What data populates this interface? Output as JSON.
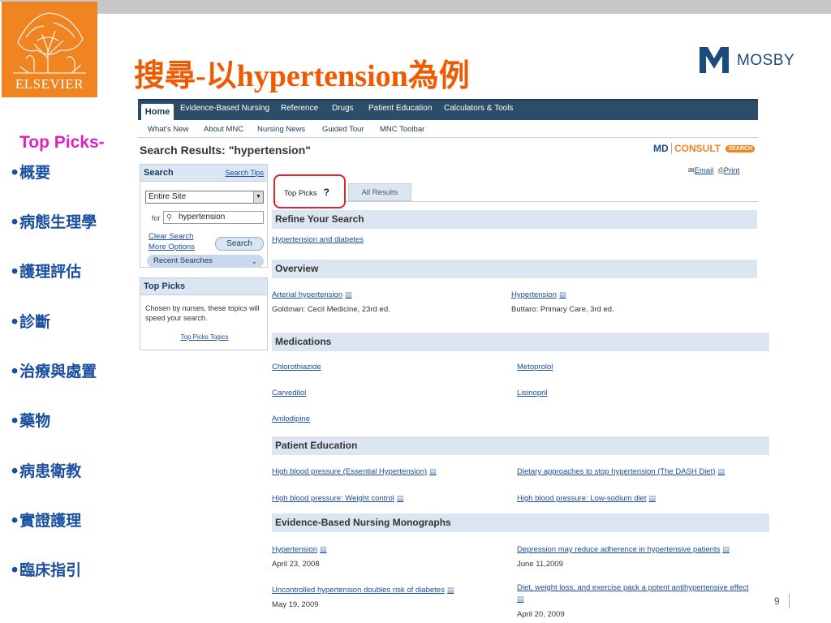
{
  "slide": {
    "title": "搜尋-以hypertension為例",
    "elsevier_label": "ELSEVIER",
    "mosby_label": "MOSBY",
    "page_number": "9"
  },
  "bullets": {
    "heading": "Top Picks-",
    "items": [
      "•概要",
      "•病態生理學",
      "•護理評估",
      "•診斷",
      "•治療與處置",
      "•藥物",
      "•病患衛教",
      "•實證護理",
      "•臨床指引"
    ]
  },
  "nav": {
    "tabs": [
      "Home",
      "Evidence-Based Nursing",
      "Reference",
      "Drugs",
      "Patient Education",
      "Calculators & Tools"
    ],
    "sub": [
      "What's New",
      "About MNC",
      "Nursing News",
      "Guided Tour",
      "MNC Toolbar"
    ]
  },
  "results": {
    "title": "Search Results: \"hypertension\"",
    "brand_md": "MD",
    "brand_consult": "CONSULT",
    "brand_search": "SEARCH",
    "email": "Email",
    "print": "Print"
  },
  "search_panel": {
    "heading": "Search",
    "tips": "Search Tips",
    "scope": "Entire Site",
    "for_label": "for",
    "query": "hypertension",
    "clear": "Clear Search",
    "more": "More Options",
    "button": "Search",
    "recent": "Recent Searches"
  },
  "top_picks_panel": {
    "heading": "Top Picks",
    "text": "Chosen by nurses, these topics will speed your search.",
    "link": "Top Picks Topics"
  },
  "tabs": {
    "top_picks": "Top Picks",
    "all_results": "All Results",
    "help": "?"
  },
  "sections": {
    "refine": {
      "heading": "Refine Your Search",
      "links": [
        "Hypertension and diabetes"
      ]
    },
    "overview": {
      "heading": "Overview",
      "items": [
        {
          "link": "Arterial hypertension",
          "meta": "Goldman: Cecil Medicine, 23rd ed."
        },
        {
          "link": "Hypertension",
          "meta": "Buttaro: Primary Care, 3rd ed."
        }
      ]
    },
    "medications": {
      "heading": "Medications",
      "links": [
        "Chlorothiazide",
        "Metoprolol",
        "Carvedilol",
        "Lisinopril",
        "Amlodipine"
      ]
    },
    "patient_education": {
      "heading": "Patient Education",
      "links": [
        "High blood pressure (Essential Hypertension)",
        "Dietary approaches to stop hypertension (The DASH Diet)",
        "High blood pressure: Weight control",
        "High blood pressure: Low-sodium diet"
      ]
    },
    "monographs": {
      "heading": "Evidence-Based Nursing Monographs",
      "items": [
        {
          "link": "Hypertension",
          "meta": "April 23, 2008"
        },
        {
          "link": "Depression may reduce adherence in hypertensive patients",
          "meta": "June 11,2009"
        },
        {
          "link": "Uncontrolled hypertension doubles risk of diabetes",
          "meta": "May 19, 2009"
        },
        {
          "link": "Diet, weight loss, and exercise pack a potent antihypertensive effect",
          "meta": "April 20, 2009"
        }
      ]
    }
  },
  "colors": {
    "title": "#ee5a00",
    "bullet_heading": "#e020c0",
    "bullet": "#1a4fa0",
    "nav": "#2b4d69",
    "section": "#dce6f2",
    "link": "#1b4b9c",
    "highlight": "#d9262c"
  }
}
